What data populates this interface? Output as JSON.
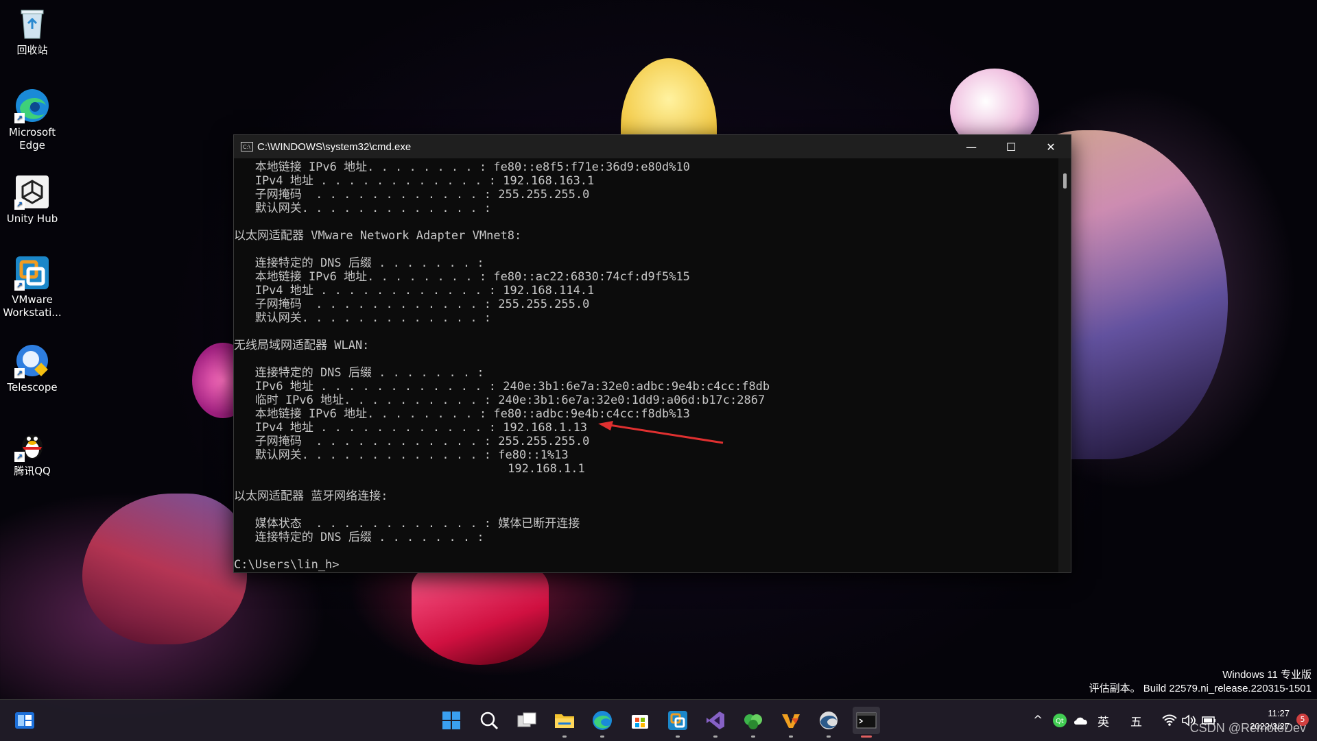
{
  "desktop": {
    "icons": [
      {
        "name": "recycle-bin",
        "label": "回收站"
      },
      {
        "name": "microsoft-edge",
        "label": "Microsoft\nEdge"
      },
      {
        "name": "unity-hub",
        "label": "Unity Hub"
      },
      {
        "name": "vmware-workstation",
        "label": "VMware\nWorkstati..."
      },
      {
        "name": "telescope",
        "label": "Telescope"
      },
      {
        "name": "tencent-qq",
        "label": "腾讯QQ"
      }
    ]
  },
  "cmd_window": {
    "title": "C:\\WINDOWS\\system32\\cmd.exe",
    "controls": {
      "minimize": "—",
      "maximize": "☐",
      "close": "✕"
    },
    "lines": [
      "   本地链接 IPv6 地址. . . . . . . . : fe80::e8f5:f71e:36d9:e80d%10",
      "   IPv4 地址 . . . . . . . . . . . . : 192.168.163.1",
      "   子网掩码  . . . . . . . . . . . . : 255.255.255.0",
      "   默认网关. . . . . . . . . . . . . :",
      "",
      "以太网适配器 VMware Network Adapter VMnet8:",
      "",
      "   连接特定的 DNS 后缀 . . . . . . . :",
      "   本地链接 IPv6 地址. . . . . . . . : fe80::ac22:6830:74cf:d9f5%15",
      "   IPv4 地址 . . . . . . . . . . . . : 192.168.114.1",
      "   子网掩码  . . . . . . . . . . . . : 255.255.255.0",
      "   默认网关. . . . . . . . . . . . . :",
      "",
      "无线局域网适配器 WLAN:",
      "",
      "   连接特定的 DNS 后缀 . . . . . . . :",
      "   IPv6 地址 . . . . . . . . . . . . : 240e:3b1:6e7a:32e0:adbc:9e4b:c4cc:f8db",
      "   临时 IPv6 地址. . . . . . . . . . : 240e:3b1:6e7a:32e0:1dd9:a06d:b17c:2867",
      "   本地链接 IPv6 地址. . . . . . . . : fe80::adbc:9e4b:c4cc:f8db%13",
      "   IPv4 地址 . . . . . . . . . . . . : 192.168.1.13",
      "   子网掩码  . . . . . . . . . . . . : 255.255.255.0",
      "   默认网关. . . . . . . . . . . . . : fe80::1%13",
      "                                       192.168.1.1",
      "",
      "以太网适配器 蓝牙网络连接:",
      "",
      "   媒体状态  . . . . . . . . . . . . : 媒体已断开连接",
      "   连接特定的 DNS 后缀 . . . . . . . :",
      "",
      "C:\\Users\\lin_h>"
    ]
  },
  "watermark": {
    "line1": "Windows 11 专业版",
    "line2": "评估副本。 Build 22579.ni_release.220315-1501"
  },
  "taskbar": {
    "items": [
      {
        "name": "widgets"
      },
      {
        "name": "start"
      },
      {
        "name": "search"
      },
      {
        "name": "task-view"
      },
      {
        "name": "file-explorer"
      },
      {
        "name": "edge"
      },
      {
        "name": "microsoft-store"
      },
      {
        "name": "vmware"
      },
      {
        "name": "visual-studio"
      },
      {
        "name": "green-app"
      },
      {
        "name": "vs-orange"
      },
      {
        "name": "edge-dev"
      },
      {
        "name": "terminal"
      }
    ],
    "tray": {
      "chevron": "^",
      "ime_lang": "英",
      "ime_mode": "五"
    },
    "clock": {
      "time": "11:27",
      "date": "2022/3/27"
    },
    "notification_count": "5"
  },
  "overlay": {
    "csdn_credit": "CSDN @RemoteDev"
  },
  "colors": {
    "console_bg": "#0c0c0c",
    "console_text": "#c8c8c8",
    "annotation_arrow": "#e03030"
  }
}
